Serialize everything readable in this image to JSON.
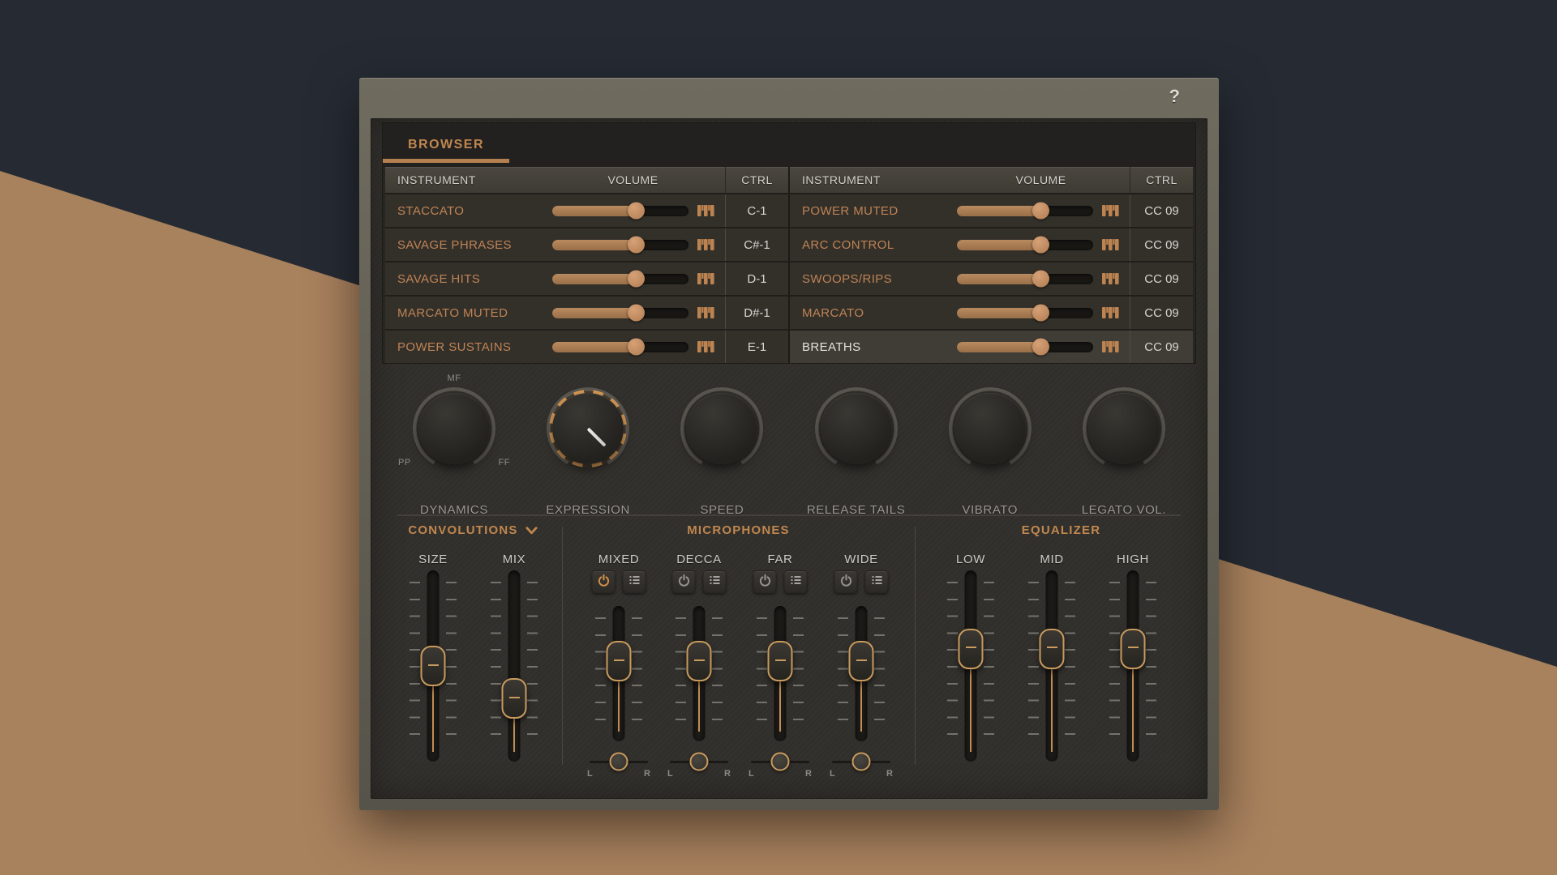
{
  "window": {
    "help_label": "?",
    "tab_label": "BROWSER"
  },
  "table": {
    "headers": {
      "instrument": "INSTRUMENT",
      "volume": "VOLUME",
      "ctrl": "CTRL"
    },
    "left_rows": [
      {
        "name": "STACCATO",
        "volume_pct": 62,
        "ctrl": "C-1"
      },
      {
        "name": "SAVAGE PHRASES",
        "volume_pct": 62,
        "ctrl": "C#-1"
      },
      {
        "name": "SAVAGE HITS",
        "volume_pct": 62,
        "ctrl": "D-1"
      },
      {
        "name": "MARCATO MUTED",
        "volume_pct": 62,
        "ctrl": "D#-1"
      },
      {
        "name": "POWER SUSTAINS",
        "volume_pct": 62,
        "ctrl": "E-1"
      }
    ],
    "right_rows": [
      {
        "name": "POWER MUTED",
        "volume_pct": 62,
        "ctrl": "CC 09"
      },
      {
        "name": "ARC CONTROL",
        "volume_pct": 62,
        "ctrl": "CC 09"
      },
      {
        "name": "SWOOPS/RIPS",
        "volume_pct": 62,
        "ctrl": "CC 09"
      },
      {
        "name": "MARCATO",
        "volume_pct": 62,
        "ctrl": "CC 09"
      },
      {
        "name": "BREATHS",
        "volume_pct": 62,
        "ctrl": "CC 09",
        "selected": true
      }
    ]
  },
  "knobs": {
    "items": [
      {
        "label": "DYNAMICS"
      },
      {
        "label": "EXPRESSION"
      },
      {
        "label": "SPEED"
      },
      {
        "label": "RELEASE TAILS"
      },
      {
        "label": "VIBRATO"
      },
      {
        "label": "LEGATO VOL."
      }
    ],
    "dynamics_markers": {
      "low": "PP",
      "mid": "MF",
      "high": "FF"
    }
  },
  "convolutions": {
    "title": "CONVOLUTIONS",
    "faders": [
      {
        "label": "SIZE",
        "value_pct": 50
      },
      {
        "label": "MIX",
        "value_pct": 67
      }
    ]
  },
  "microphones": {
    "title": "MICROPHONES",
    "pan_left": "L",
    "pan_right": "R",
    "channels": [
      {
        "label": "MIXED",
        "power_on": true,
        "fader_pct": 41
      },
      {
        "label": "DECCA",
        "power_on": false,
        "fader_pct": 41
      },
      {
        "label": "FAR",
        "power_on": false,
        "fader_pct": 41
      },
      {
        "label": "WIDE",
        "power_on": false,
        "fader_pct": 41
      }
    ]
  },
  "equalizer": {
    "title": "EQUALIZER",
    "faders": [
      {
        "label": "LOW",
        "value_pct": 41
      },
      {
        "label": "MID",
        "value_pct": 41
      },
      {
        "label": "HIGH",
        "value_pct": 41
      }
    ]
  },
  "colors": {
    "accent": "#c78a50",
    "bg_dark": "#262b33",
    "bg_tan": "#a8815d"
  }
}
